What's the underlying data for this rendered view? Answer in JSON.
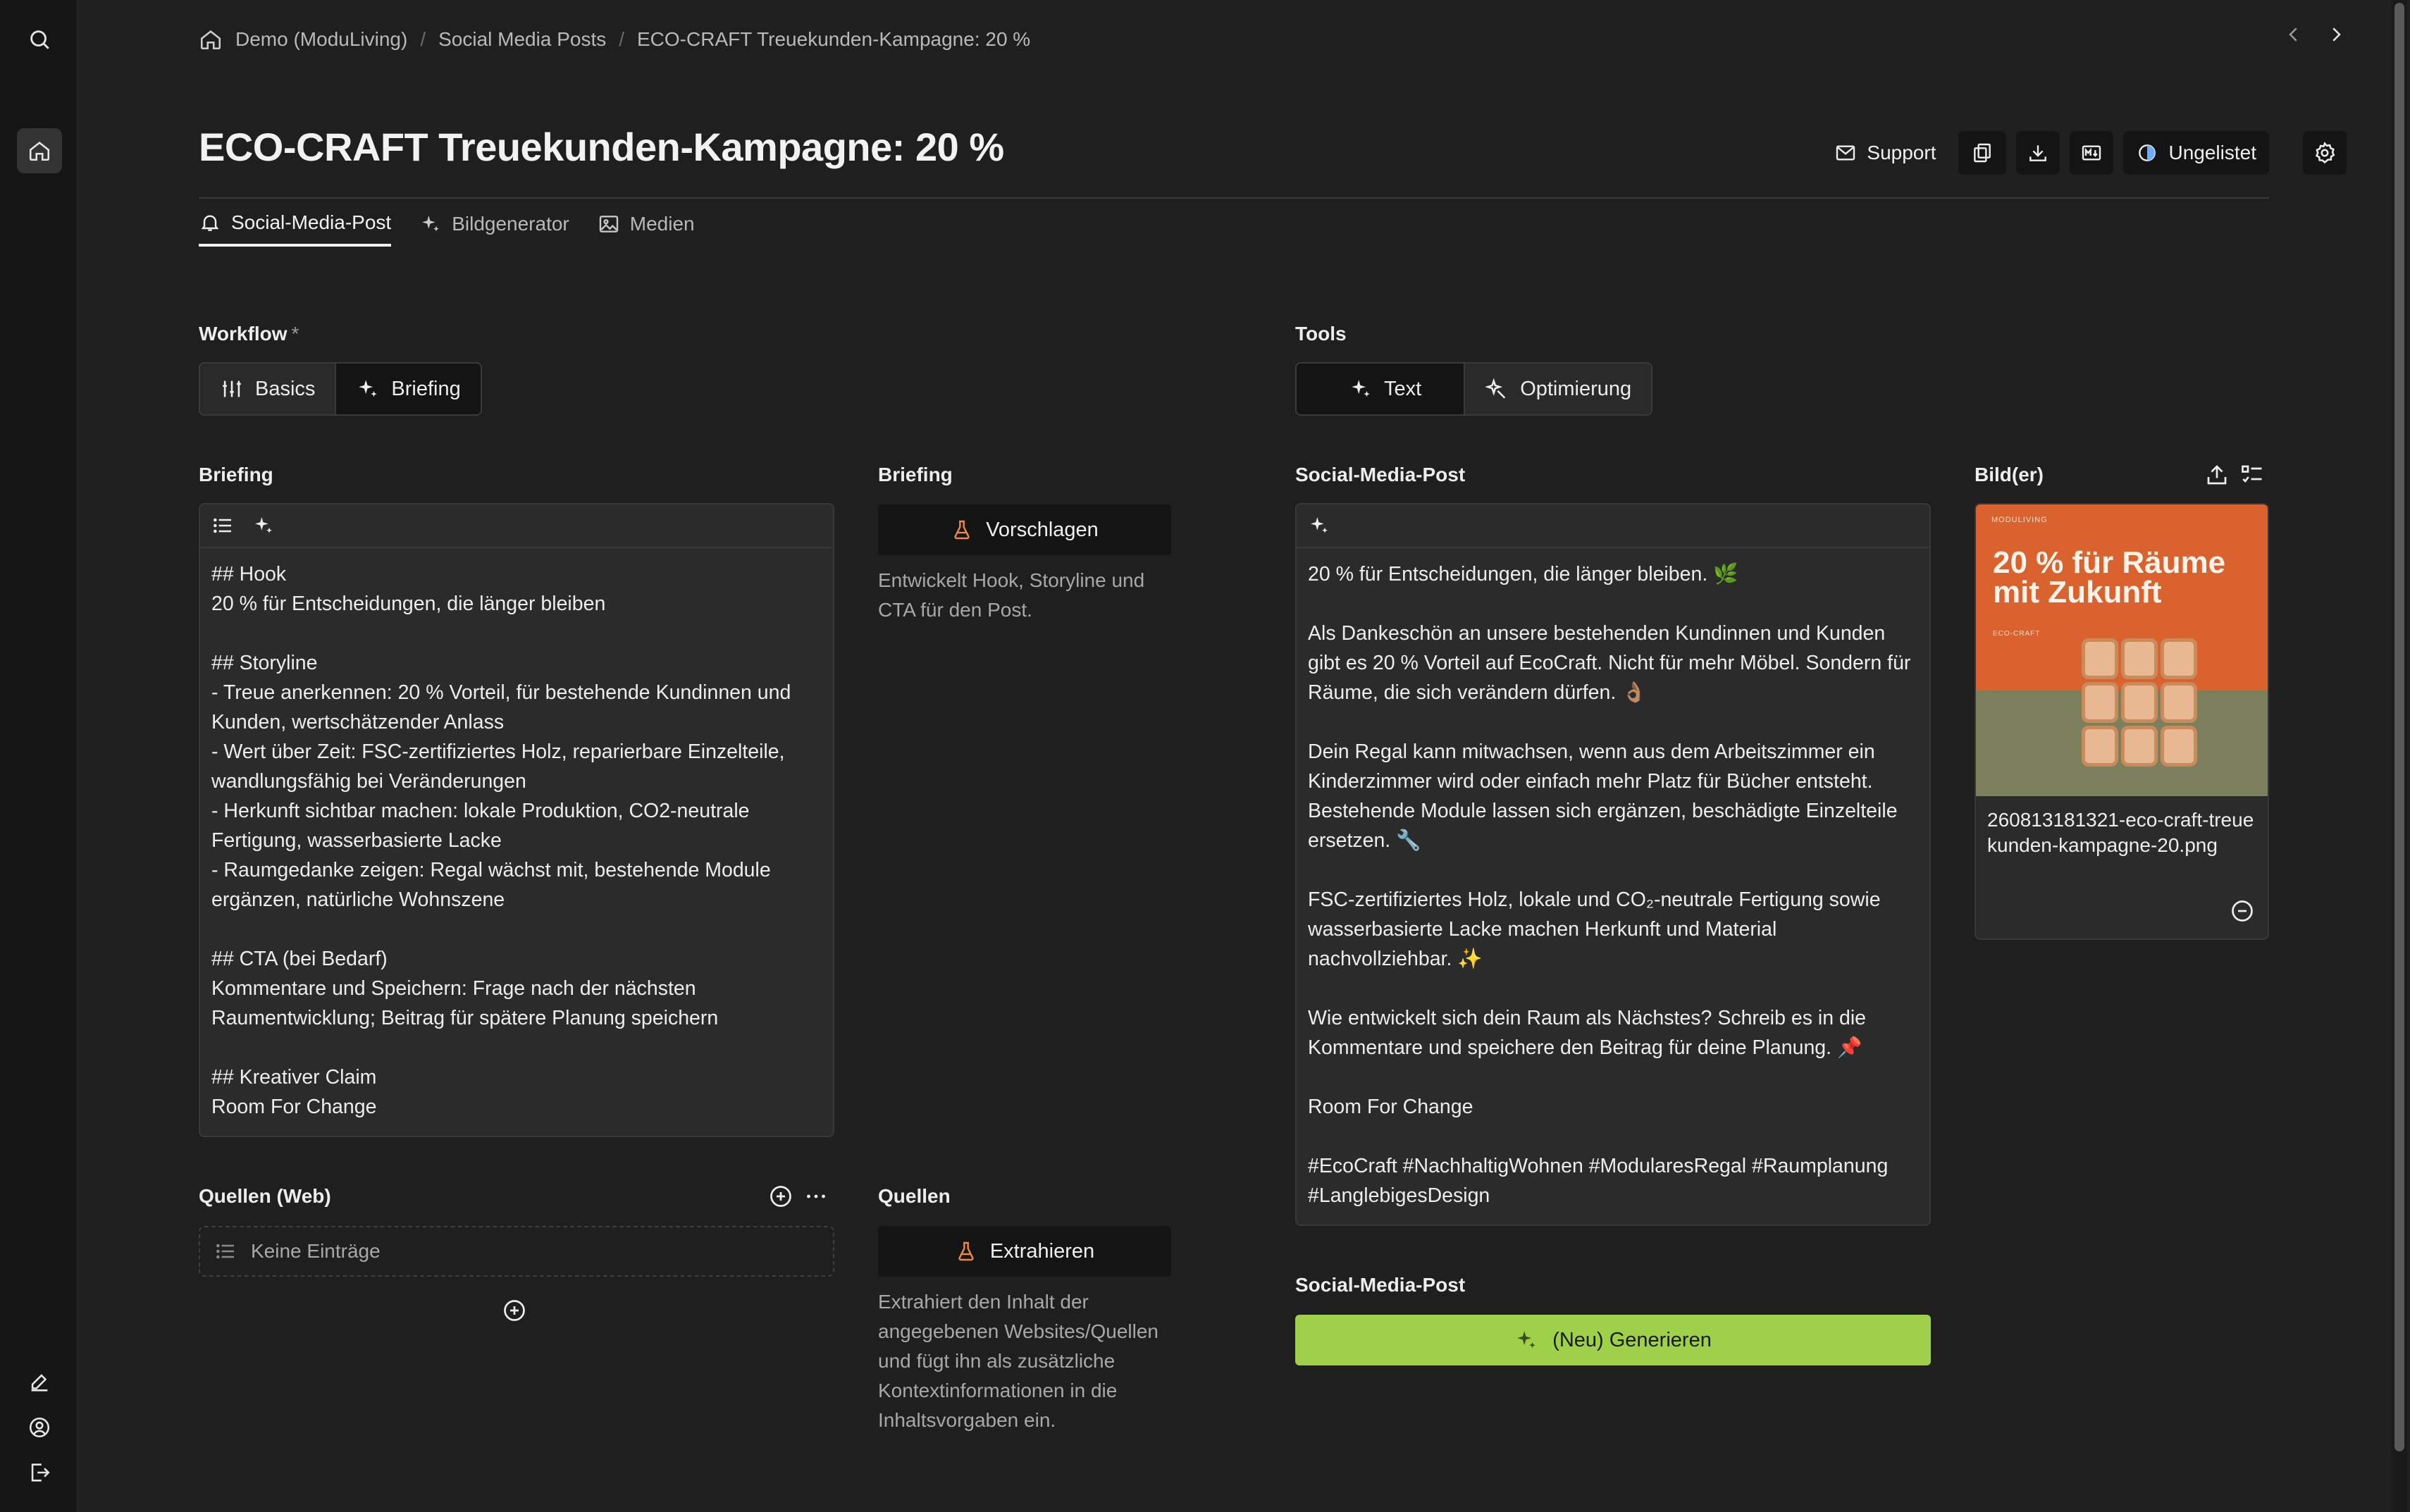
{
  "breadcrumb": {
    "items": [
      "Demo (ModuLiving)",
      "Social Media Posts",
      "ECO-CRAFT Treuekunden-Kampagne: 20 %"
    ],
    "separator": "/"
  },
  "page": {
    "title": "ECO-CRAFT Treuekunden-Kampagne: 20 %"
  },
  "actions": {
    "support": "Support",
    "visibility": "Ungelistet"
  },
  "tabs": [
    {
      "label": "Social-Media-Post",
      "icon": "bell-icon",
      "active": true
    },
    {
      "label": "Bildgenerator",
      "icon": "sparkles-icon",
      "active": false
    },
    {
      "label": "Medien",
      "icon": "image-icon",
      "active": false
    }
  ],
  "workflow": {
    "label": "Workflow",
    "required": "*",
    "options": [
      "Basics",
      "Briefing"
    ],
    "selected": "Briefing"
  },
  "tools": {
    "label": "Tools",
    "options": [
      "Text",
      "Optimierung"
    ],
    "selected": "Text"
  },
  "briefing_editor": {
    "label": "Briefing",
    "content": "## Hook\n20 % für Entscheidungen, die länger bleiben\n\n## Storyline\n- Treue anerkennen: 20 % Vorteil, für bestehende Kundinnen und Kunden, wertschätzender Anlass\n- Wert über Zeit: FSC-zertifiziertes Holz, reparierbare Einzelteile, wandlungsfähig bei Veränderungen\n- Herkunft sichtbar machen: lokale Produktion, CO2-neutrale Fertigung, wasserbasierte Lacke\n- Raumgedanke zeigen: Regal wächst mit, bestehende Module ergänzen, natürliche Wohnszene\n\n## CTA (bei Bedarf)\nKommentare und Speichern: Frage nach der nächsten Raumentwicklung; Beitrag für spätere Planung speichern\n\n## Kreativer Claim\nRoom For Change"
  },
  "briefing_tool": {
    "label": "Briefing",
    "button": "Vorschlagen",
    "hint": "Entwickelt Hook, Storyline und CTA für den Post."
  },
  "sources_web": {
    "label": "Quellen (Web)",
    "empty": "Keine Einträge"
  },
  "sources_tool": {
    "label": "Quellen",
    "button": "Extrahieren",
    "hint": "Extrahiert den Inhalt der angegebenen Websites/Quellen und fügt ihn als zusätzliche Kontextinformationen in die Inhaltsvorgaben ein."
  },
  "post": {
    "label": "Social-Media-Post",
    "content": "20 % für Entscheidungen, die länger bleiben. 🌿\n\nAls Dankeschön an unsere bestehenden Kundinnen und Kunden gibt es 20 % Vorteil auf EcoCraft. Nicht für mehr Möbel. Sondern für Räume, die sich verändern dürfen. 👌🏽\n\nDein Regal kann mitwachsen, wenn aus dem Arbeitszimmer ein Kinderzimmer wird oder einfach mehr Platz für Bücher entsteht. Bestehende Module lassen sich ergänzen, beschädigte Einzelteile ersetzen. 🔧\n\nFSC-zertifiziertes Holz, lokale und CO₂-neutrale Fertigung sowie wasserbasierte Lacke machen Herkunft und Material nachvollziehbar. ✨\n\nWie entwickelt sich dein Raum als Nächstes? Schreib es in die Kommentare und speichere den Beitrag für deine Planung. 📌\n\nRoom For Change\n\n#EcoCraft #NachhaltigWohnen #ModularesRegal #Raumplanung #LanglebigesDesign"
  },
  "generate": {
    "label": "Social-Media-Post",
    "button": "(Neu) Generieren",
    "color": "#9fd04a"
  },
  "images": {
    "label": "Bild(er)",
    "items": [
      {
        "filename": "260813181321-eco-craft-treuekunden-kampagne-20.png",
        "brand": "MODULIVING",
        "headline": "20 % für Räume mit Zukunft",
        "sub": "ECO-CRAFT"
      }
    ]
  }
}
